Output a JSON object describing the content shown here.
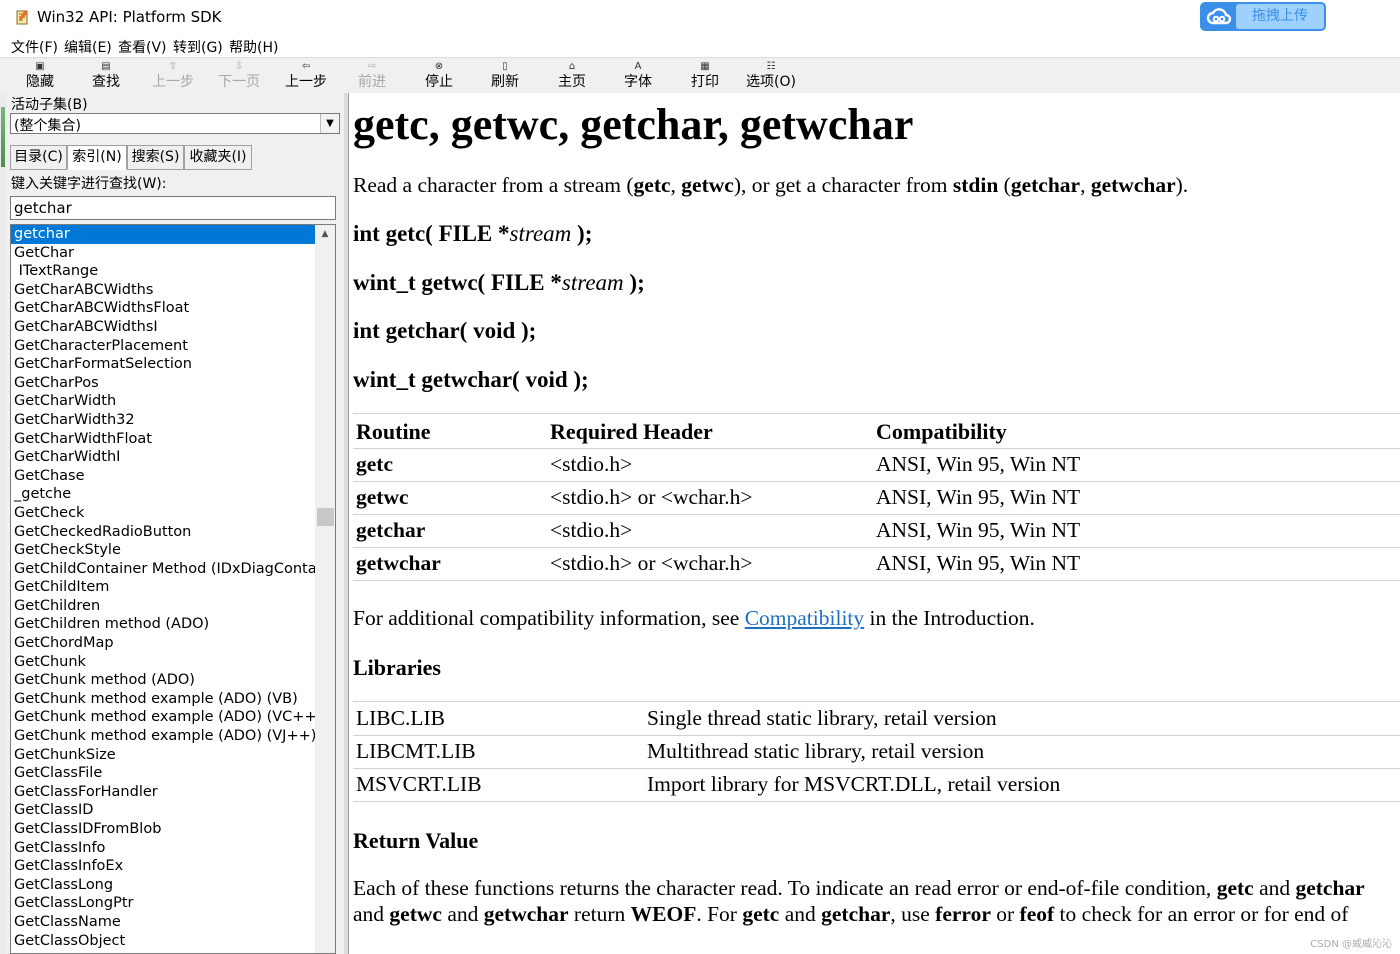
{
  "window": {
    "title": "Win32 API: Platform SDK",
    "upload_button": "拖拽上传"
  },
  "menu": [
    "文件(F)",
    "编辑(E)",
    "查看(V)",
    "转到(G)",
    "帮助(H)"
  ],
  "toolbar": [
    {
      "label": "隐藏",
      "icon": "hide-icon",
      "enabled": true
    },
    {
      "label": "查找",
      "icon": "locate-icon",
      "enabled": true
    },
    {
      "label": "上一步",
      "icon": "previous-icon",
      "enabled": false
    },
    {
      "label": "下一页",
      "icon": "next-icon",
      "enabled": false
    },
    {
      "label": "上一步",
      "icon": "back-icon",
      "enabled": true
    },
    {
      "label": "前进",
      "icon": "forward-icon",
      "enabled": false
    },
    {
      "label": "停止",
      "icon": "stop-icon",
      "enabled": true
    },
    {
      "label": "刷新",
      "icon": "refresh-icon",
      "enabled": true
    },
    {
      "label": "主页",
      "icon": "home-icon",
      "enabled": true
    },
    {
      "label": "字体",
      "icon": "font-icon",
      "enabled": true
    },
    {
      "label": "打印",
      "icon": "print-icon",
      "enabled": true
    },
    {
      "label": "选项(O)",
      "icon": "options-icon",
      "enabled": true
    }
  ],
  "left": {
    "subset_label": "活动子集(B)",
    "subset_value": "(整个集合)",
    "tabs": [
      "目录(C)",
      "索引(N)",
      "搜索(S)",
      "收藏夹(I)"
    ],
    "keyword_label": "键入关键字进行查找(W):",
    "keyword_value": "getchar",
    "index_items": [
      "getchar",
      "GetChar",
      " ITextRange",
      "GetCharABCWidths",
      "GetCharABCWidthsFloat",
      "GetCharABCWidthsI",
      "GetCharacterPlacement",
      "GetCharFormatSelection",
      "GetCharPos",
      "GetCharWidth",
      "GetCharWidth32",
      "GetCharWidthFloat",
      "GetCharWidthI",
      "GetChase",
      "_getche",
      "GetCheck",
      "GetCheckedRadioButton",
      "GetCheckStyle",
      "GetChildContainer Method (IDxDiagContainer)",
      "GetChildItem",
      "GetChildren",
      "GetChildren method (ADO)",
      "GetChordMap",
      "GetChunk",
      "GetChunk method (ADO)",
      "GetChunk method example (ADO) (VB)",
      "GetChunk method example (ADO) (VC++)",
      "GetChunk method example (ADO) (VJ++)",
      "GetChunkSize",
      "GetClassFile",
      "GetClassForHandler",
      "GetClassID",
      "GetClassIDFromBlob",
      "GetClassInfo",
      "GetClassInfoEx",
      "GetClassLong",
      "GetClassLongPtr",
      "GetClassName",
      "GetClassObject"
    ],
    "selected_index": 0
  },
  "doc": {
    "title": "getc, getwc, getchar, getwchar",
    "intro": {
      "t1": "Read a character from a stream (",
      "b1": "getc",
      "t2": ", ",
      "b2": "getwc",
      "t3": "), or get a character from ",
      "b3": "stdin",
      "t4": " (",
      "b4": "getchar",
      "t5": ", ",
      "b5": "getwchar",
      "t6": ")."
    },
    "prototypes": [
      {
        "pre": "int getc( FILE *",
        "arg": "stream",
        "post": " );"
      },
      {
        "pre": "wint_t getwc( FILE *",
        "arg": "stream",
        "post": " );"
      },
      {
        "pre": "int getchar( void );",
        "arg": "",
        "post": ""
      },
      {
        "pre": "wint_t getwchar( void );",
        "arg": "",
        "post": ""
      }
    ],
    "routine_table": {
      "headers": [
        "Routine",
        "Required Header",
        "Compatibility"
      ],
      "rows": [
        [
          "getc",
          "<stdio.h>",
          "ANSI, Win 95, Win NT"
        ],
        [
          "getwc",
          "<stdio.h> or <wchar.h>",
          "ANSI, Win 95, Win NT"
        ],
        [
          "getchar",
          "<stdio.h>",
          "ANSI, Win 95, Win NT"
        ],
        [
          "getwchar",
          "<stdio.h> or <wchar.h>",
          "ANSI, Win 95, Win NT"
        ]
      ]
    },
    "compat_note": {
      "pre": "For additional compatibility information, see ",
      "link": "Compatibility",
      "post": " in the Introduction."
    },
    "libraries_heading": "Libraries",
    "libraries": [
      [
        "LIBC.LIB",
        "Single thread static library, retail version"
      ],
      [
        "LIBCMT.LIB",
        "Multithread static library, retail version"
      ],
      [
        "MSVCRT.LIB",
        "Import library for MSVCRT.DLL, retail version"
      ]
    ],
    "return_heading": "Return Value",
    "return_line1": {
      "t1": "Each of these functions returns the character read. To indicate an read error or end-of-file condition, ",
      "b1": "getc",
      "t2": " and ",
      "b2": "getchar"
    },
    "return_line2": {
      "t1": "and ",
      "b1": "getwc",
      "t2": " and ",
      "b2": "getwchar",
      "t3": " return ",
      "b3": "WEOF",
      "t4": ". For ",
      "b4": "getc",
      "t5": " and ",
      "b5": "getchar",
      "t6": ", use ",
      "b6": "ferror",
      "t7": " or ",
      "b7": "feof",
      "t8": " to check for an error or for end of"
    }
  },
  "watermark": "CSDN @威威沁沁"
}
